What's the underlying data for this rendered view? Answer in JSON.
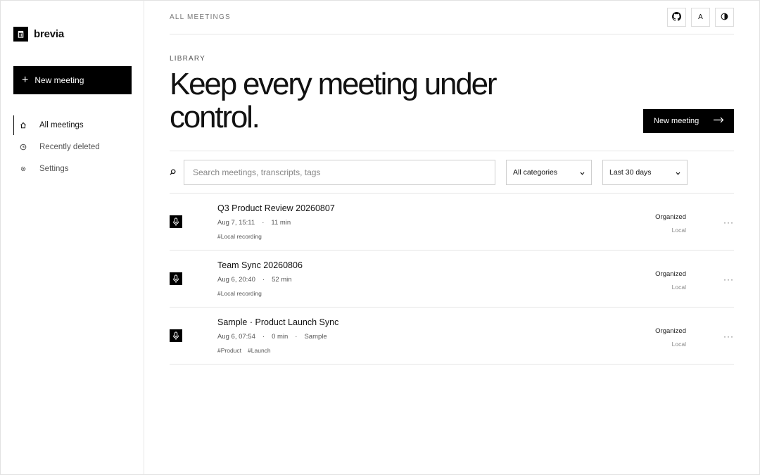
{
  "brand": {
    "name": "brevia",
    "icon": "trash-icon"
  },
  "sidebar": {
    "new_meeting": "New meeting",
    "items": [
      {
        "label": "All meetings",
        "icon": "home-icon",
        "active": true
      },
      {
        "label": "Recently deleted",
        "icon": "clock-icon",
        "active": false
      },
      {
        "label": "Settings",
        "icon": "gear-icon",
        "active": false
      }
    ]
  },
  "header": {
    "breadcrumb": "ALL MEETINGS",
    "actions": [
      {
        "label": "",
        "icon": "github-icon"
      },
      {
        "label": "A",
        "icon": "language-icon"
      },
      {
        "label": "",
        "icon": "contrast-icon"
      }
    ]
  },
  "main": {
    "section_label": "LIBRARY",
    "title": "Keep every meeting under control.",
    "new_meeting": "New meeting",
    "search_placeholder": "Search meetings, transcripts, tags",
    "category_filter": "All categories",
    "range_filter": "Last 30 days"
  },
  "meetings": [
    {
      "title": "Q3 Product Review 20260807",
      "date": "Aug 7, 15:11",
      "duration": "11 min",
      "extra": "",
      "tags": [
        "#Local recording"
      ],
      "status": "Organized",
      "source": "Local"
    },
    {
      "title": "Team Sync 20260806",
      "date": "Aug 6, 20:40",
      "duration": "52 min",
      "extra": "",
      "tags": [
        "#Local recording"
      ],
      "status": "Organized",
      "source": "Local"
    },
    {
      "title": "Sample · Product Launch Sync",
      "date": "Aug 6, 07:54",
      "duration": "0 min",
      "extra": "Sample",
      "tags": [
        "#Product",
        "#Launch"
      ],
      "status": "Organized",
      "source": "Local"
    }
  ],
  "colors": {
    "accent": "#000000",
    "border": "#e6e6e6",
    "muted": "#555555"
  }
}
